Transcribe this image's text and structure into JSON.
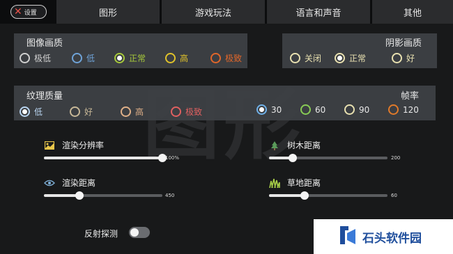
{
  "header": {
    "back_label": "设置",
    "tabs": [
      {
        "label": "图形",
        "active": true
      },
      {
        "label": "游戏玩法"
      },
      {
        "label": "语言和声音"
      },
      {
        "label": "其他"
      }
    ]
  },
  "watermark": "图形",
  "image_quality": {
    "title": "图像画质",
    "options": [
      {
        "label": "极低",
        "color": "#d0d0d0"
      },
      {
        "label": "低",
        "color": "#6fa3d8"
      },
      {
        "label": "正常",
        "color": "#a6c83a",
        "selected": true
      },
      {
        "label": "高",
        "color": "#e0c22a"
      },
      {
        "label": "极致",
        "color": "#e0662a"
      }
    ]
  },
  "shadow_quality": {
    "title": "阴影画质",
    "options": [
      {
        "label": "关闭",
        "color": "#e8e0b0"
      },
      {
        "label": "正常",
        "color": "#e8e0b0",
        "selected": true
      },
      {
        "label": "好",
        "color": "#e8e0b0"
      }
    ]
  },
  "texture_quality": {
    "title": "纹理质量",
    "options": [
      {
        "label": "低",
        "color": "#b8d4f0",
        "selected": true
      },
      {
        "label": "好",
        "color": "#c8b898"
      },
      {
        "label": "高",
        "color": "#e0b088"
      },
      {
        "label": "极致",
        "color": "#e06060"
      }
    ]
  },
  "frame_rate": {
    "title": "帧率",
    "options": [
      {
        "label": "30",
        "color": "#6fb0e8",
        "selected": true
      },
      {
        "label": "60",
        "color": "#88cc55"
      },
      {
        "label": "90",
        "color": "#e8e0b0"
      },
      {
        "label": "120",
        "color": "#e07a2a"
      }
    ]
  },
  "sliders": {
    "render_resolution": {
      "label": "渲染分辨率",
      "value": "100%",
      "fraction": 1.0,
      "icon": "image-icon"
    },
    "render_distance": {
      "label": "渲染距离",
      "value": "450",
      "fraction": 0.3,
      "icon": "eye-icon"
    },
    "tree_distance": {
      "label": "树木距离",
      "value": "200",
      "fraction": 0.2,
      "icon": "tree-icon"
    },
    "grass_distance": {
      "label": "草地距离",
      "value": "60",
      "fraction": 0.3,
      "icon": "grass-icon"
    }
  },
  "reflection_probe": {
    "label": "反射探测",
    "enabled": false
  },
  "brand": {
    "name": "石头软件园"
  }
}
